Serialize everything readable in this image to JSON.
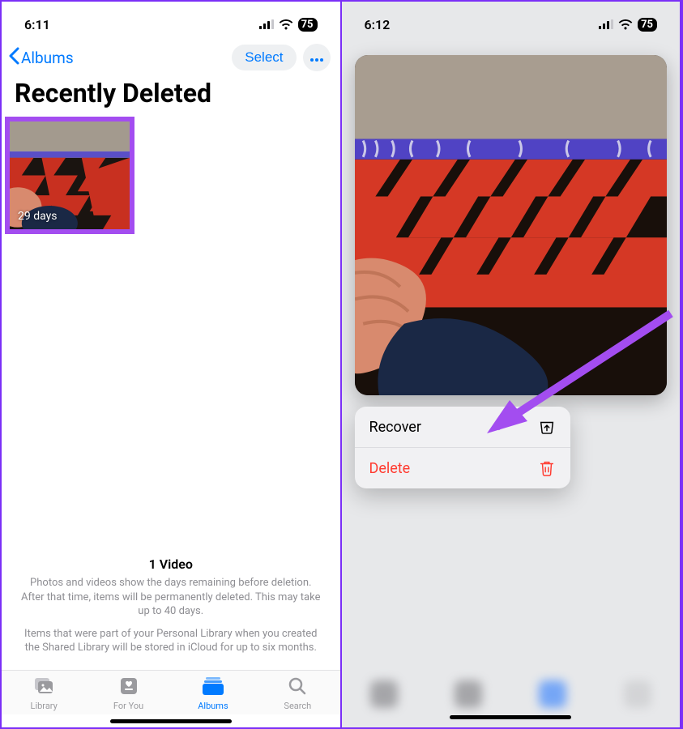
{
  "left": {
    "status": {
      "time": "6:11",
      "battery": "75"
    },
    "nav": {
      "back_label": "Albums",
      "select_label": "Select"
    },
    "title": "Recently Deleted",
    "thumbnail": {
      "days_label": "29 days"
    },
    "info": {
      "title": "1 Video",
      "p1": "Photos and videos show the days remaining before deletion. After that time, items will be permanently deleted. This may take up to 40 days.",
      "p2": "Items that were part of your Personal Library when you created the Shared Library will be stored in iCloud for up to six months."
    },
    "tabs": {
      "library": "Library",
      "for_you": "For You",
      "albums": "Albums",
      "search": "Search"
    }
  },
  "right": {
    "status": {
      "time": "6:12",
      "battery": "75"
    },
    "menu": {
      "recover": "Recover",
      "delete": "Delete"
    }
  }
}
